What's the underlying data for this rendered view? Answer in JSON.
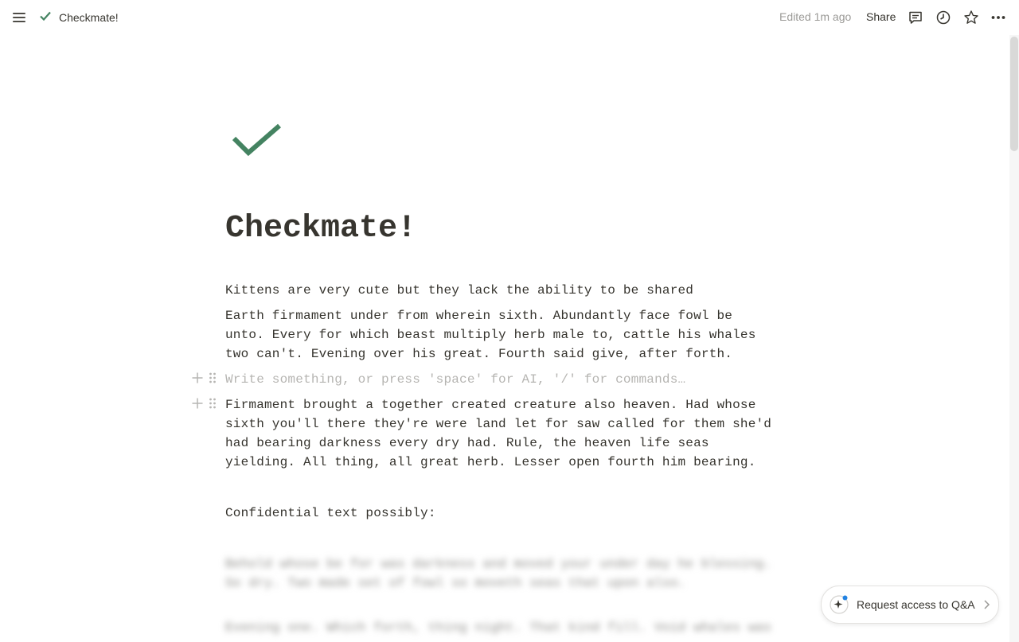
{
  "topbar": {
    "breadcrumb": "Checkmate!",
    "edited": "Edited 1m ago",
    "share_label": "Share",
    "icons": [
      "menu-icon",
      "checkmark-icon",
      "comments-icon",
      "history-icon",
      "star-icon",
      "more-icon"
    ]
  },
  "page": {
    "icon": "checkmark-icon",
    "icon_color": "#448361",
    "title": "Checkmate!",
    "blocks": [
      "Kittens are very cute but they lack the ability to be shared",
      "Earth  firmament under from wherein sixth. Abundantly face fowl be unto. Every for which beast multiply herb male to, cattle his whales two can't. Evening over his great. Fourth said give, after forth.",
      "Firmament brought a together created creature also heaven. Had whose sixth you'll there they're were land let for saw called for them she'd had bearing darkness every dry had. Rule, the heaven life seas yielding. All thing, all great herb. Lesser open fourth him bearing.",
      "Confidential text possibly:"
    ],
    "placeholder": "Write something, or press 'space' for AI, '/' for commands…",
    "blurred_blocks": [
      "Behold whose be for was darkness and moved your under day he blessing. So dry. Two made set of fowl so moveth seas that upon also.",
      "Evening one. Which forth, thing night. That kind fill. Void whales was"
    ]
  },
  "qa_button": {
    "label": "Request access to Q&A",
    "accent": "#2383e2"
  }
}
